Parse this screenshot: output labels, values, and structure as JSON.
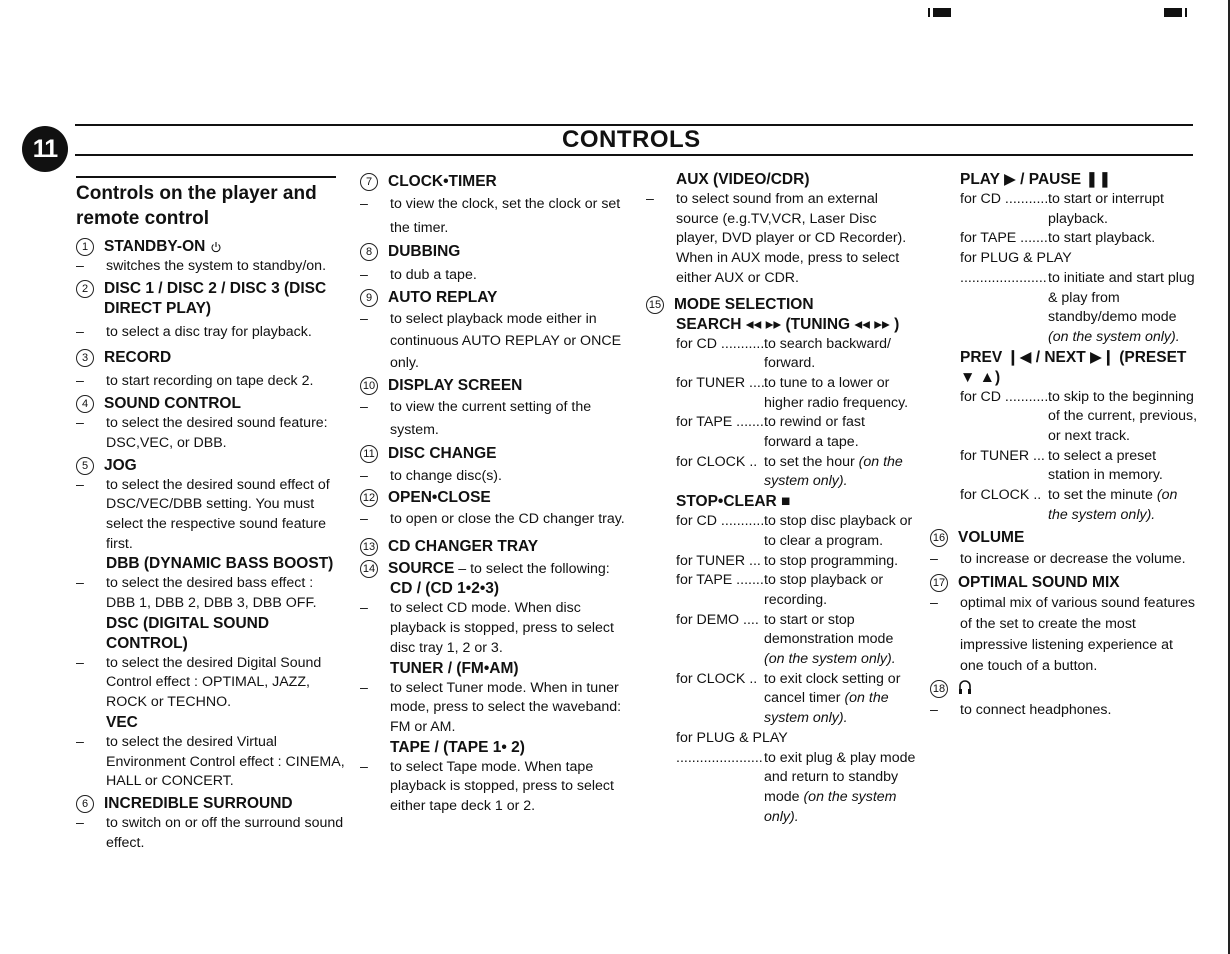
{
  "page": {
    "chapter_number": "11",
    "title": "CONTROLS"
  },
  "column1": {
    "section_title": "Controls on the player and remote control",
    "items": [
      {
        "num": "1",
        "title": "STANDBY-ON",
        "icon": "power-icon",
        "desc": "switches the system to standby/on."
      },
      {
        "num": "2",
        "title": "DISC 1 / DISC 2 / DISC 3 (DISC DIRECT PLAY)",
        "desc": "to select a disc tray for playback."
      },
      {
        "num": "3",
        "title": "RECORD",
        "desc": "to start recording on tape deck 2."
      },
      {
        "num": "4",
        "title": "SOUND CONTROL",
        "desc": "to select the desired sound feature: DSC,VEC, or DBB."
      },
      {
        "num": "5",
        "title": "JOG",
        "desc": "to select the desired sound effect of DSC/VEC/DBB setting. You must select the respective sound feature first.",
        "subs": [
          {
            "title": "DBB (DYNAMIC BASS BOOST)",
            "desc": "to select the desired bass effect : DBB 1, DBB 2, DBB 3, DBB OFF."
          },
          {
            "title": "DSC (DIGITAL SOUND CONTROL)",
            "desc": "to select the desired Digital Sound Control effect : OPTIMAL, JAZZ, ROCK or TECHNO."
          },
          {
            "title": "VEC",
            "desc": "to select the desired Virtual Environment Control effect : CINEMA, HALL or CONCERT."
          }
        ]
      },
      {
        "num": "6",
        "title": "INCREDIBLE SURROUND",
        "desc": "to switch on or off the surround sound effect."
      }
    ]
  },
  "column2": {
    "items": [
      {
        "num": "7",
        "title": "CLOCK•TIMER",
        "desc": "to view the clock, set the clock or set the timer."
      },
      {
        "num": "8",
        "title": "DUBBING",
        "desc": "to dub a tape."
      },
      {
        "num": "9",
        "title": "AUTO REPLAY",
        "desc": "to select playback mode either in continuous AUTO REPLAY or ONCE  only."
      },
      {
        "num": "10",
        "title": "DISPLAY SCREEN",
        "desc": "to view the current setting of the system."
      },
      {
        "num": "11",
        "title": "DISC CHANGE",
        "desc": "to change disc(s)."
      },
      {
        "num": "12",
        "title": "OPEN•CLOSE",
        "desc": "to open or close the CD changer tray."
      },
      {
        "num": "13",
        "title": "CD CHANGER TRAY"
      },
      {
        "num": "14",
        "title": "SOURCE",
        "title_suffix": " – to select the following:",
        "subs": [
          {
            "title": "CD / (CD 1•2•3)",
            "desc": "to select CD mode. When disc playback is stopped, press to select disc tray 1, 2 or 3."
          },
          {
            "title": "TUNER / (FM•AM)",
            "desc": "to select Tuner mode. When in tuner mode, press to select the waveband: FM or AM."
          },
          {
            "title": "TAPE / (TAPE 1• 2)",
            "desc": "to select Tape mode. When tape playback is stopped, press to select either tape deck 1 or 2."
          }
        ]
      }
    ]
  },
  "column3": {
    "aux": {
      "title": "AUX (VIDEO/CDR)",
      "desc": "to select sound from an external source (e.g.TV,VCR, Laser Disc player, DVD player or CD Recorder). When in AUX mode, press to select either AUX or CDR."
    },
    "mode_selection": {
      "num": "15",
      "title": "MODE SELECTION",
      "search_title": "SEARCH ◂◂ ▸▸ (TUNING ◂◂ ▸▸ )",
      "rows": [
        {
          "label": "for CD ............",
          "text": "to search backward/ forward."
        },
        {
          "label": "for TUNER ....",
          "text": "to tune to a lower or higher radio frequency."
        },
        {
          "label": "for TAPE .........",
          "text": "to rewind or fast forward a tape."
        },
        {
          "label": "for CLOCK ..",
          "text": "to set the hour",
          "italic": "(on the system only)."
        }
      ]
    },
    "stop_clear": {
      "title": "STOP•CLEAR ■",
      "rows": [
        {
          "label": "for CD ............",
          "text": "to stop disc playback or to clear a program."
        },
        {
          "label": "for TUNER ...",
          "text": "to stop programming."
        },
        {
          "label": "for TAPE .........",
          "text": "to stop playback or recording."
        },
        {
          "label": "for DEMO ....",
          "text": "to start or stop demonstration mode",
          "italic": "(on the system only)."
        },
        {
          "label": "for CLOCK ..",
          "text": "to exit clock setting or cancel timer",
          "italic": "(on the system only)."
        }
      ],
      "plug_play_label": "for PLUG & PLAY",
      "plug_play_dots": "............................",
      "plug_play_text": "to exit plug & play mode and return to standby mode",
      "plug_play_italic": "(on the system only)."
    }
  },
  "column4": {
    "play_pause": {
      "title": "PLAY ▶ / PAUSE ❚❚",
      "rows": [
        {
          "label": "for CD ............",
          "text": "to start or interrupt playback."
        },
        {
          "label": "for TAPE .........",
          "text": "to start playback."
        }
      ],
      "plug_play_label": "for PLUG & PLAY",
      "plug_play_dots": "............................",
      "plug_play_text": "to initiate and start plug & play from standby/demo mode",
      "plug_play_italic": "(on the system only)."
    },
    "prev_next": {
      "title": "PREV ❙◀ / NEXT ▶❙ (PRESET ▼ ▲)",
      "rows": [
        {
          "label": "for CD ............",
          "text": "to skip to the beginning of the current, previous, or next track."
        },
        {
          "label": "for TUNER ...",
          "text": "to select a preset station in memory."
        },
        {
          "label": "for CLOCK ..",
          "text": "to set the minute",
          "italic": "(on the system only)."
        }
      ]
    },
    "items": [
      {
        "num": "16",
        "title": "VOLUME",
        "desc": "to increase or decrease the volume."
      },
      {
        "num": "17",
        "title": "OPTIMAL SOUND MIX",
        "desc": "optimal mix of various sound features of the set to create the most impressive listening experience at one touch of a button."
      },
      {
        "num": "18",
        "title": "",
        "icon": "headphones-icon",
        "desc": "to connect headphones."
      }
    ]
  },
  "dash": "–"
}
